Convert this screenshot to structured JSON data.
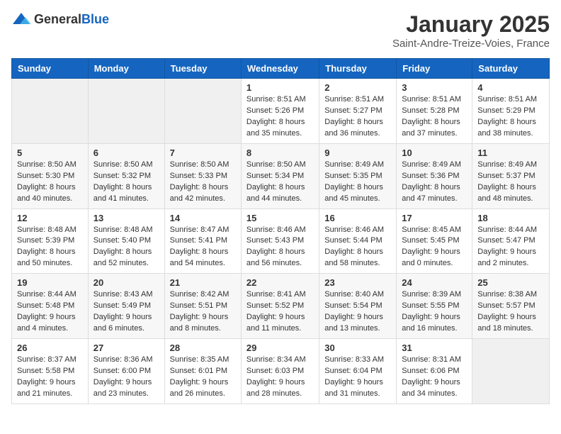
{
  "header": {
    "logo_general": "General",
    "logo_blue": "Blue",
    "month": "January 2025",
    "location": "Saint-Andre-Treize-Voies, France"
  },
  "days_of_week": [
    "Sunday",
    "Monday",
    "Tuesday",
    "Wednesday",
    "Thursday",
    "Friday",
    "Saturday"
  ],
  "weeks": [
    [
      {
        "day": "",
        "info": ""
      },
      {
        "day": "",
        "info": ""
      },
      {
        "day": "",
        "info": ""
      },
      {
        "day": "1",
        "info": "Sunrise: 8:51 AM\nSunset: 5:26 PM\nDaylight: 8 hours and 35 minutes."
      },
      {
        "day": "2",
        "info": "Sunrise: 8:51 AM\nSunset: 5:27 PM\nDaylight: 8 hours and 36 minutes."
      },
      {
        "day": "3",
        "info": "Sunrise: 8:51 AM\nSunset: 5:28 PM\nDaylight: 8 hours and 37 minutes."
      },
      {
        "day": "4",
        "info": "Sunrise: 8:51 AM\nSunset: 5:29 PM\nDaylight: 8 hours and 38 minutes."
      }
    ],
    [
      {
        "day": "5",
        "info": "Sunrise: 8:50 AM\nSunset: 5:30 PM\nDaylight: 8 hours and 40 minutes."
      },
      {
        "day": "6",
        "info": "Sunrise: 8:50 AM\nSunset: 5:32 PM\nDaylight: 8 hours and 41 minutes."
      },
      {
        "day": "7",
        "info": "Sunrise: 8:50 AM\nSunset: 5:33 PM\nDaylight: 8 hours and 42 minutes."
      },
      {
        "day": "8",
        "info": "Sunrise: 8:50 AM\nSunset: 5:34 PM\nDaylight: 8 hours and 44 minutes."
      },
      {
        "day": "9",
        "info": "Sunrise: 8:49 AM\nSunset: 5:35 PM\nDaylight: 8 hours and 45 minutes."
      },
      {
        "day": "10",
        "info": "Sunrise: 8:49 AM\nSunset: 5:36 PM\nDaylight: 8 hours and 47 minutes."
      },
      {
        "day": "11",
        "info": "Sunrise: 8:49 AM\nSunset: 5:37 PM\nDaylight: 8 hours and 48 minutes."
      }
    ],
    [
      {
        "day": "12",
        "info": "Sunrise: 8:48 AM\nSunset: 5:39 PM\nDaylight: 8 hours and 50 minutes."
      },
      {
        "day": "13",
        "info": "Sunrise: 8:48 AM\nSunset: 5:40 PM\nDaylight: 8 hours and 52 minutes."
      },
      {
        "day": "14",
        "info": "Sunrise: 8:47 AM\nSunset: 5:41 PM\nDaylight: 8 hours and 54 minutes."
      },
      {
        "day": "15",
        "info": "Sunrise: 8:46 AM\nSunset: 5:43 PM\nDaylight: 8 hours and 56 minutes."
      },
      {
        "day": "16",
        "info": "Sunrise: 8:46 AM\nSunset: 5:44 PM\nDaylight: 8 hours and 58 minutes."
      },
      {
        "day": "17",
        "info": "Sunrise: 8:45 AM\nSunset: 5:45 PM\nDaylight: 9 hours and 0 minutes."
      },
      {
        "day": "18",
        "info": "Sunrise: 8:44 AM\nSunset: 5:47 PM\nDaylight: 9 hours and 2 minutes."
      }
    ],
    [
      {
        "day": "19",
        "info": "Sunrise: 8:44 AM\nSunset: 5:48 PM\nDaylight: 9 hours and 4 minutes."
      },
      {
        "day": "20",
        "info": "Sunrise: 8:43 AM\nSunset: 5:49 PM\nDaylight: 9 hours and 6 minutes."
      },
      {
        "day": "21",
        "info": "Sunrise: 8:42 AM\nSunset: 5:51 PM\nDaylight: 9 hours and 8 minutes."
      },
      {
        "day": "22",
        "info": "Sunrise: 8:41 AM\nSunset: 5:52 PM\nDaylight: 9 hours and 11 minutes."
      },
      {
        "day": "23",
        "info": "Sunrise: 8:40 AM\nSunset: 5:54 PM\nDaylight: 9 hours and 13 minutes."
      },
      {
        "day": "24",
        "info": "Sunrise: 8:39 AM\nSunset: 5:55 PM\nDaylight: 9 hours and 16 minutes."
      },
      {
        "day": "25",
        "info": "Sunrise: 8:38 AM\nSunset: 5:57 PM\nDaylight: 9 hours and 18 minutes."
      }
    ],
    [
      {
        "day": "26",
        "info": "Sunrise: 8:37 AM\nSunset: 5:58 PM\nDaylight: 9 hours and 21 minutes."
      },
      {
        "day": "27",
        "info": "Sunrise: 8:36 AM\nSunset: 6:00 PM\nDaylight: 9 hours and 23 minutes."
      },
      {
        "day": "28",
        "info": "Sunrise: 8:35 AM\nSunset: 6:01 PM\nDaylight: 9 hours and 26 minutes."
      },
      {
        "day": "29",
        "info": "Sunrise: 8:34 AM\nSunset: 6:03 PM\nDaylight: 9 hours and 28 minutes."
      },
      {
        "day": "30",
        "info": "Sunrise: 8:33 AM\nSunset: 6:04 PM\nDaylight: 9 hours and 31 minutes."
      },
      {
        "day": "31",
        "info": "Sunrise: 8:31 AM\nSunset: 6:06 PM\nDaylight: 9 hours and 34 minutes."
      },
      {
        "day": "",
        "info": ""
      }
    ]
  ]
}
